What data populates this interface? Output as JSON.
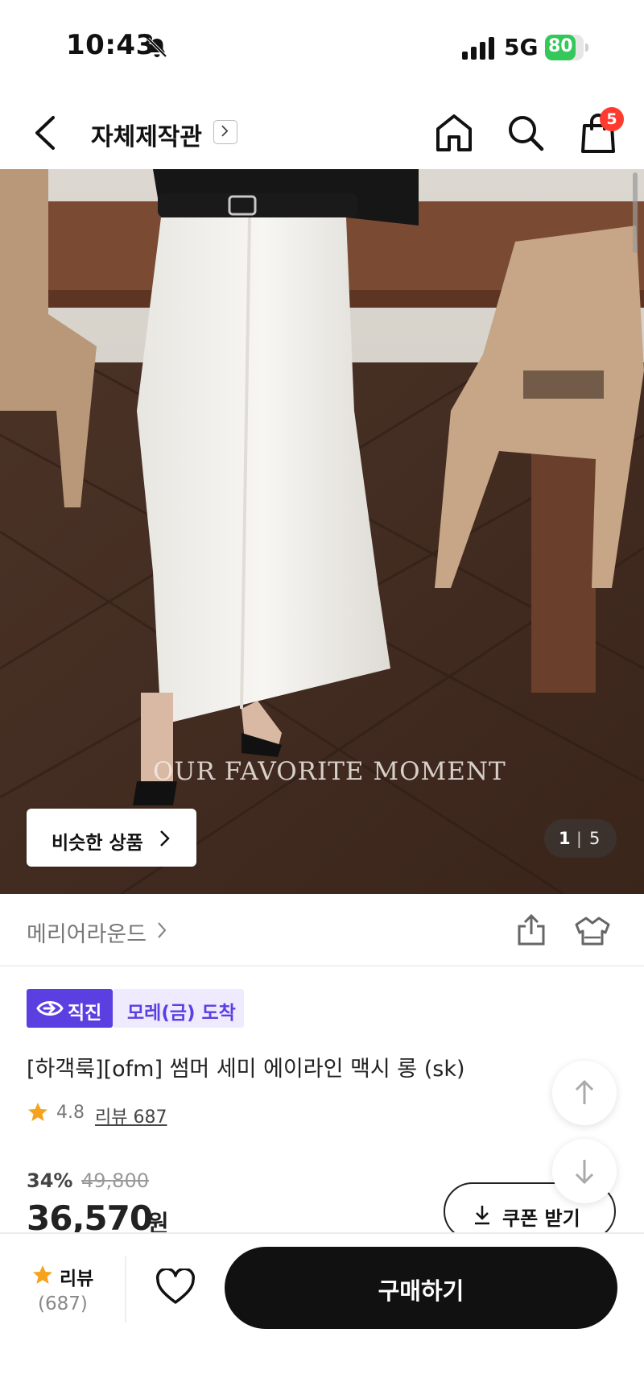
{
  "status_bar": {
    "time": "10:43",
    "network": "5G",
    "battery_percent": 80,
    "battery_label": "80"
  },
  "nav": {
    "store_title": "자체제작관",
    "cart_count": "5"
  },
  "hero": {
    "overlay_text": "OUR FAVORITE MOMENT",
    "similar_button": "비슷한 상품",
    "pager_current": "1",
    "pager_separator": "|",
    "pager_total": "5"
  },
  "product": {
    "brand": "메리어라운드",
    "badge_direct": "직진",
    "badge_arrival": "모레(금) 도착",
    "title": "[하객룩][ofm] 썸머 세미 에이라인 맥시 롱 (sk)",
    "rating": "4.8",
    "review_link": "리뷰 687",
    "discount": "34%",
    "original_price": "49,800",
    "price": "36,570",
    "price_unit": "원",
    "coupon_button": "쿠폰 받기"
  },
  "bottom_bar": {
    "review_label": "리뷰",
    "review_count": "(687)",
    "buy_button": "구매하기"
  },
  "colors": {
    "accent_purple": "#5c3fe0",
    "badge_red": "#ff3b30",
    "star": "#f7a21b",
    "battery_green": "#34c759"
  }
}
